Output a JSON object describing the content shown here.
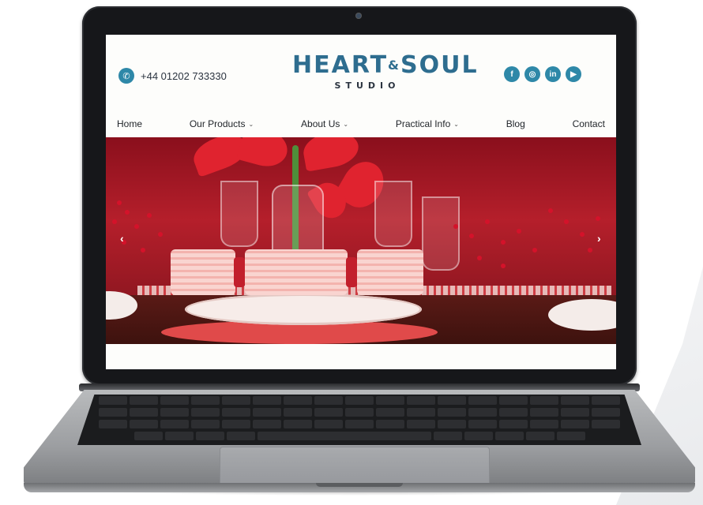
{
  "site": {
    "phone": "+44 01202 733330",
    "logo": {
      "main_left": "HEART",
      "amp": "&",
      "main_right": "SOUL",
      "sub": "STUDIO"
    },
    "socials": [
      {
        "icon": "facebook-icon",
        "glyph": "f"
      },
      {
        "icon": "instagram-icon",
        "glyph": "◎"
      },
      {
        "icon": "linkedin-icon",
        "glyph": "in"
      },
      {
        "icon": "youtube-icon",
        "glyph": "▶"
      }
    ],
    "nav": [
      {
        "label": "Home",
        "dropdown": false
      },
      {
        "label": "Our Products",
        "dropdown": true
      },
      {
        "label": "About Us",
        "dropdown": true
      },
      {
        "label": "Practical Info",
        "dropdown": true
      },
      {
        "label": "Blog",
        "dropdown": false
      },
      {
        "label": "Contact",
        "dropdown": false
      }
    ],
    "hero": {
      "prev_glyph": "‹",
      "next_glyph": "›"
    }
  },
  "colors": {
    "accent": "#2e88a8",
    "logo": "#2e6d8f",
    "hero_red": "#b51f2b"
  }
}
